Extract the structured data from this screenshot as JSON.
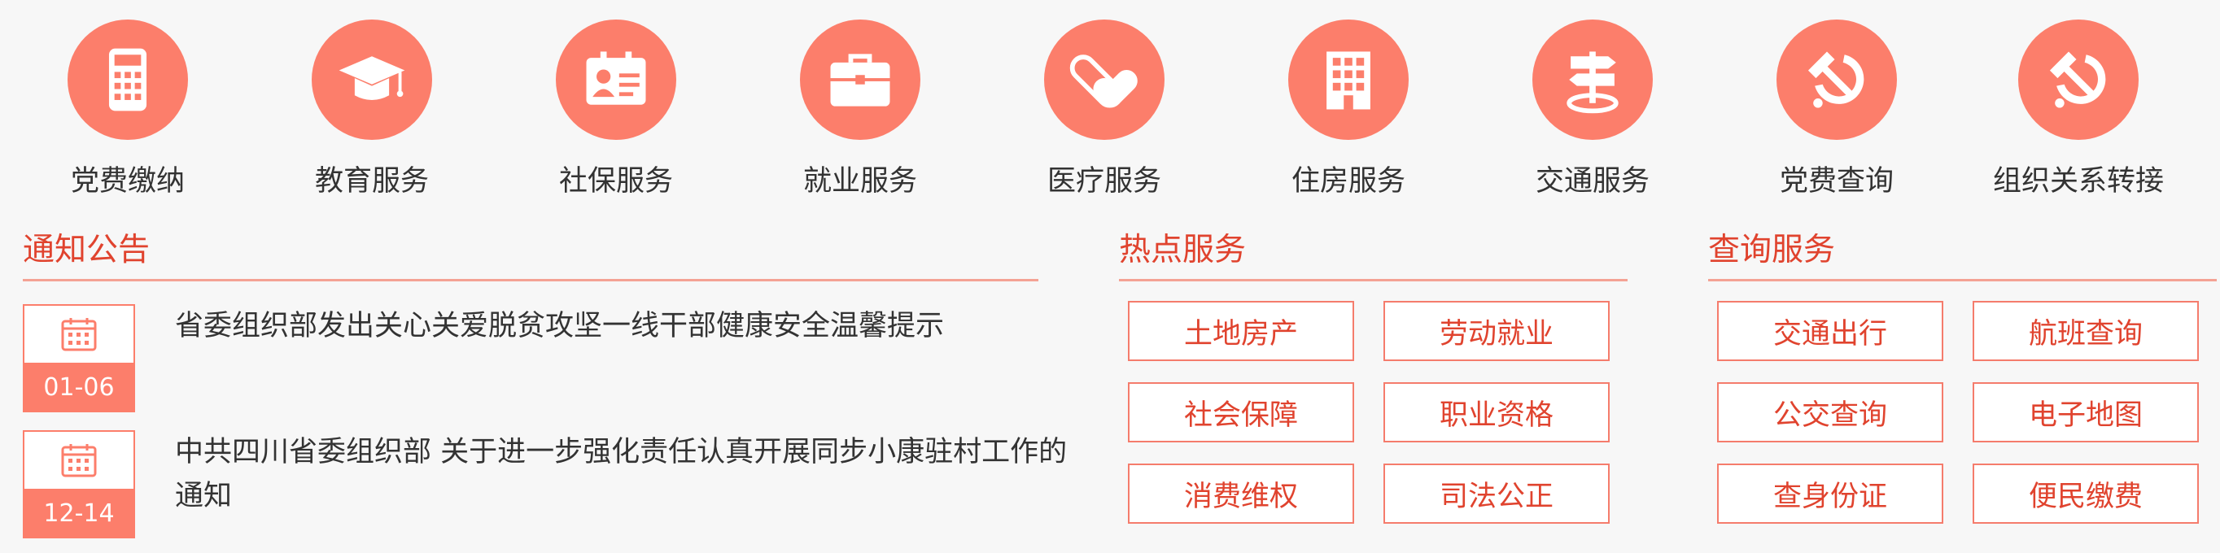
{
  "services": [
    {
      "label": "党费缴纳",
      "icon": "calculator-icon"
    },
    {
      "label": "教育服务",
      "icon": "graduation-cap-icon"
    },
    {
      "label": "社保服务",
      "icon": "id-card-icon"
    },
    {
      "label": "就业服务",
      "icon": "briefcase-icon"
    },
    {
      "label": "医疗服务",
      "icon": "pill-icon"
    },
    {
      "label": "住房服务",
      "icon": "building-icon"
    },
    {
      "label": "交通服务",
      "icon": "signpost-icon"
    },
    {
      "label": "党费查询",
      "icon": "hammer-sickle-icon"
    },
    {
      "label": "组织关系转接",
      "icon": "hammer-sickle-icon"
    }
  ],
  "notices": {
    "title": "通知公告",
    "items": [
      {
        "date": "01-06",
        "text": "省委组织部发出关心关爱脱贫攻坚一线干部健康安全温馨提示"
      },
      {
        "date": "12-14",
        "text": "中共四川省委组织部 关于进一步强化责任认真开展同步小康驻村工作的通知"
      }
    ]
  },
  "hot_services": {
    "title": "热点服务",
    "buttons": [
      "土地房产",
      "劳动就业",
      "社会保障",
      "职业资格",
      "消费维权",
      "司法公正"
    ]
  },
  "query_services": {
    "title": "查询服务",
    "buttons": [
      "交通出行",
      "航班查询",
      "公交查询",
      "电子地图",
      "查身份证",
      "便民缴费"
    ]
  },
  "colors": {
    "accent": "#fc7e6b",
    "title_red": "#e0432e",
    "line": "#f4a294"
  }
}
